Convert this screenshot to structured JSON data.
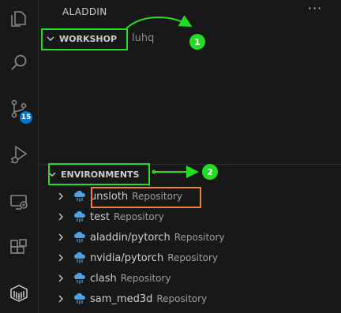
{
  "sidebar": {
    "title": "ALADDIN",
    "more_icon": "more-horizontal-icon"
  },
  "activity_bar": {
    "items": [
      {
        "icon": "explorer-icon"
      },
      {
        "icon": "search-icon"
      },
      {
        "icon": "source-control-icon",
        "badge": "15"
      },
      {
        "icon": "run-debug-icon"
      },
      {
        "icon": "remote-explorer-icon"
      },
      {
        "icon": "extensions-icon"
      },
      {
        "icon": "aladdin-icon"
      }
    ]
  },
  "workshop": {
    "label": "WORKSHOP",
    "sub": "luhq"
  },
  "environments": {
    "label": "ENVIRONMENTS",
    "items": [
      {
        "name": "unsloth",
        "type": "Repository"
      },
      {
        "name": "test",
        "type": "Repository"
      },
      {
        "name": "aladdin/pytorch",
        "type": "Repository"
      },
      {
        "name": "nvidia/pytorch",
        "type": "Repository"
      },
      {
        "name": "clash",
        "type": "Repository"
      },
      {
        "name": "sam_med3d",
        "type": "Repository"
      }
    ]
  },
  "annotations": {
    "callout_1": "1",
    "callout_2": "2"
  },
  "colors": {
    "background": "#181818",
    "annotation_green": "#22dd22",
    "annotation_orange": "#f08040",
    "badge_blue": "#0078d4",
    "cloud_blue": "#4aa3e8"
  }
}
